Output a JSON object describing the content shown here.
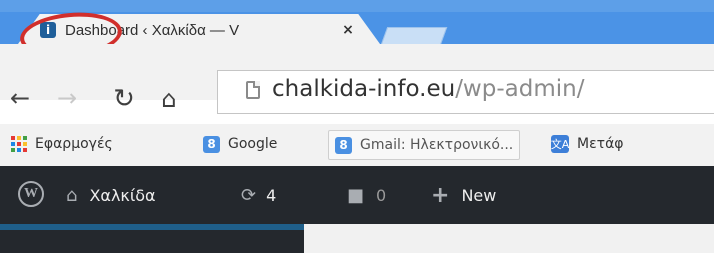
{
  "browser": {
    "tab_title": "Dashboard ‹ Χαλκίδα — V",
    "tab_favicon_letter": "i",
    "close_glyph": "×",
    "address_domain": "chalkida-info.eu",
    "address_path": "/wp-admin/"
  },
  "nav": {
    "back_icon": "arrow-left-icon",
    "forward_icon": "arrow-right-icon",
    "reload_icon": "reload-icon",
    "home_icon": "home-icon"
  },
  "bookmarks": [
    {
      "label": "Εφαρμογές",
      "icon": "apps-grid-icon"
    },
    {
      "label": "Google",
      "icon": "google-8-icon",
      "icon_text": "8"
    },
    {
      "label": "Gmail: Ηλεκτρονικό...",
      "icon": "google-8-icon",
      "icon_text": "8"
    },
    {
      "label": "Μετάφ",
      "icon": "translate-icon",
      "icon_text": "文A"
    }
  ],
  "wp_admin_bar": {
    "logo_letter": "W",
    "site_name": "Χαλκίδα",
    "updates_count": "4",
    "comments_count": "0",
    "new_label": "New"
  },
  "colors": {
    "frame": "#4b93e6",
    "annotation": "#d12f2c",
    "admin_bar": "#24282d",
    "admin_accent": "#1f5f8a"
  }
}
